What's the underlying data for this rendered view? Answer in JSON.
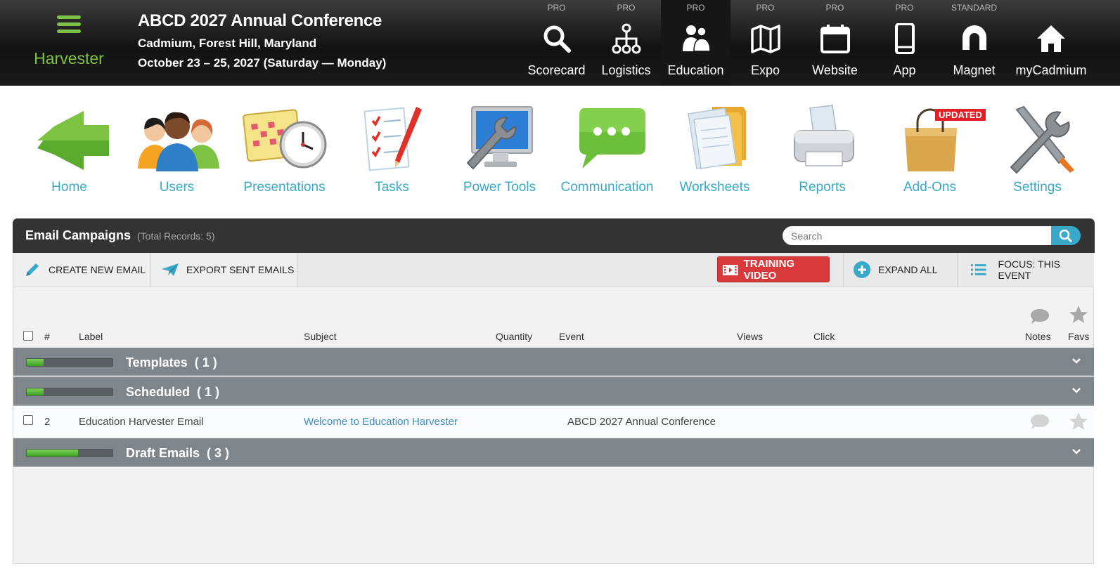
{
  "app": {
    "name": "Harvester"
  },
  "event": {
    "title": "ABCD 2027 Annual Conference",
    "location": "Cadmium, Forest Hill, Maryland",
    "dates": "October 23 – 25, 2027 (Saturday — Monday)"
  },
  "modules": [
    {
      "tier": "PRO",
      "label": "Scorecard",
      "icon": "search-icon"
    },
    {
      "tier": "PRO",
      "label": "Logistics",
      "icon": "org-chart-icon"
    },
    {
      "tier": "PRO",
      "label": "Education",
      "icon": "people-icon",
      "active": true
    },
    {
      "tier": "PRO",
      "label": "Expo",
      "icon": "map-icon"
    },
    {
      "tier": "PRO",
      "label": "Website",
      "icon": "calendar-icon"
    },
    {
      "tier": "PRO",
      "label": "App",
      "icon": "phone-icon"
    },
    {
      "tier": "STANDARD",
      "label": "Magnet",
      "icon": "magnet-icon"
    },
    {
      "tier": "",
      "label": "myCadmium",
      "icon": "home-icon"
    }
  ],
  "nav": [
    {
      "label": "Home",
      "icon": "back-arrow-icon"
    },
    {
      "label": "Users",
      "icon": "users-icon"
    },
    {
      "label": "Presentations",
      "icon": "calendar-clock-icon"
    },
    {
      "label": "Tasks",
      "icon": "checklist-icon"
    },
    {
      "label": "Power Tools",
      "icon": "monitor-wrench-icon"
    },
    {
      "label": "Communication",
      "icon": "speech-bubble-icon"
    },
    {
      "label": "Worksheets",
      "icon": "folders-icon"
    },
    {
      "label": "Reports",
      "icon": "printer-icon"
    },
    {
      "label": "Add-Ons",
      "icon": "shopping-bag-icon",
      "badge": "UPDATED"
    },
    {
      "label": "Settings",
      "icon": "tools-icon"
    }
  ],
  "panel": {
    "title": "Email Campaigns",
    "count": "(Total Records: 5)",
    "search_placeholder": "Search"
  },
  "toolbar": {
    "create": "CREATE NEW EMAIL",
    "export": "EXPORT SENT EMAILS",
    "training": "TRAINING VIDEO",
    "expand": "EXPAND ALL",
    "focus": "FOCUS: THIS EVENT"
  },
  "columns": {
    "num": "#",
    "label": "Label",
    "subject": "Subject",
    "quantity": "Quantity",
    "event": "Event",
    "views": "Views",
    "click": "Click",
    "notes": "Notes",
    "favs": "Favs"
  },
  "groups": [
    {
      "label": "Templates",
      "count": "( 1 )",
      "progress": 0.2
    },
    {
      "label": "Scheduled",
      "count": "( 1 )",
      "progress": 0.2
    },
    {
      "label": "Draft Emails",
      "count": "( 3 )",
      "progress": 0.6
    }
  ],
  "rows": [
    {
      "num": "2",
      "label": "Education Harvester Email",
      "subject": "Welcome to Education Harvester",
      "event": "ABCD 2027 Annual Conference"
    }
  ],
  "colors": {
    "accent_green": "#7dc242",
    "link_blue": "#3aa8c8",
    "training_red": "#d9393b",
    "group_gray": "#7f868b"
  }
}
